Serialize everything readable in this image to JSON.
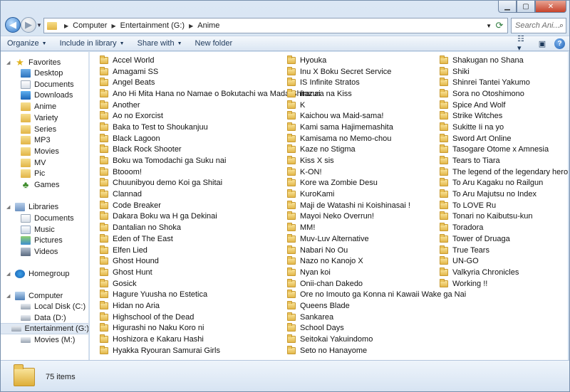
{
  "address": {
    "crumbs": [
      "Computer",
      "Entertainment (G:)",
      "Anime"
    ]
  },
  "search": {
    "placeholder": "Search Ani..."
  },
  "toolbar": {
    "organize": "Organize",
    "include_in_library": "Include in library",
    "share_with": "Share with",
    "new_folder": "New folder"
  },
  "nav": {
    "favorites": "Favorites",
    "favorites_items": [
      "Desktop",
      "Documents",
      "Downloads",
      "Anime",
      "Variety",
      "Series",
      "MP3",
      "Movies",
      "MV",
      "Pic",
      "Games"
    ],
    "libraries": "Libraries",
    "libraries_items": [
      "Documents",
      "Music",
      "Pictures",
      "Videos"
    ],
    "homegroup": "Homegroup",
    "computer": "Computer",
    "computer_items": [
      "Local Disk (C:)",
      "Data (D:)",
      "Entertainment (G:)",
      "Movies (M:)"
    ]
  },
  "folders": {
    "col1": [
      "Accel World",
      "Amagami SS",
      "Angel Beats",
      "Ano Hi Mita Hana no Namae o Bokutachi wa Mada Shiranai",
      "Another",
      "Ao no Exorcist",
      "Baka to Test to Shoukanjuu",
      "Black Lagoon",
      "Black Rock Shooter",
      "Boku wa Tomodachi ga Suku nai",
      "Btooom!",
      "Chuunibyou demo Koi ga Shitai",
      "Clannad",
      "Code Breaker",
      "Dakara Boku wa H ga Dekinai",
      "Dantalian no Shoka",
      "Eden of The East",
      "Elfen Lied",
      "Ghost Hound",
      "Ghost Hunt",
      "Gosick",
      "Hagure Yuusha no Estetica",
      "Hidan no Aria",
      "Highschool of the Dead",
      "Higurashi no Naku Koro ni",
      "Hoshizora e Kakaru Hashi",
      "Hyakka Ryouran Samurai Girls"
    ],
    "col2": [
      "Hyouka",
      "Inu X Boku Secret Service",
      "IS Infinite Stratos",
      "Itazura na Kiss",
      "K",
      "Kaichou wa Maid-sama!",
      "Kami sama Hajimemashita",
      "Kamisama no Memo-chou",
      "Kaze no Stigma",
      "Kiss X sis",
      "K-ON!",
      "Kore wa Zombie Desu",
      "KuroKami",
      "Maji de Watashi ni Koishinasai !",
      "Mayoi Neko Overrun!",
      "MM!",
      "Muv-Luv Alternative",
      "Nabari No Ou",
      "Nazo no Kanojo X",
      "Nyan koi",
      "Onii-chan Dakedo",
      "Ore no Imouto ga Konna ni Kawaii Wake ga Nai",
      "Queens Blade",
      "Sankarea",
      "School Days",
      "Seitokai Yakuindomo",
      "Seto no Hanayome"
    ],
    "col3": [
      "Shakugan no Shana",
      "Shiki",
      "Shinrei Tantei Yakumo",
      "Sora no Otoshimono",
      "Spice And Wolf",
      "Strike Witches",
      "Sukitte Ii na yo",
      "Sword Art Online",
      "Tasogare Otome x Amnesia",
      "Tears to Tiara",
      "The legend of the legendary heroes",
      "To Aru Kagaku no Railgun",
      "To Aru Majutsu no Index",
      "To LOVE Ru",
      "Tonari no Kaibutsu-kun",
      "Toradora",
      "Tower of Druaga",
      "True Tears",
      "UN-GO",
      "Valkyria Chronicles",
      "Working !!"
    ]
  },
  "status": {
    "item_count": "75 items"
  },
  "colors": {
    "accent": "#1e395b",
    "selection": "#dfe8f3",
    "folder": "#e3b84b"
  }
}
